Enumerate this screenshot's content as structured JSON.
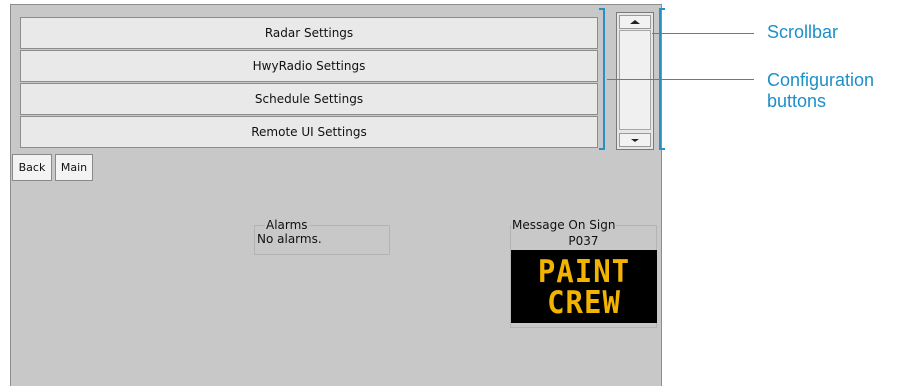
{
  "config_buttons": [
    "Radar Settings",
    "HwyRadio Settings",
    "Schedule Settings",
    "Remote UI Settings"
  ],
  "nav": {
    "back_label": "Back",
    "main_label": "Main"
  },
  "alarms": {
    "title": "Alarms",
    "status": "No alarms."
  },
  "sign": {
    "title": "Message On Sign",
    "code": "P037",
    "lines": [
      "PAINT",
      "CREW"
    ]
  },
  "callouts": {
    "scrollbar": "Scrollbar",
    "config_line1": "Configuration",
    "config_line2": "buttons"
  },
  "colors": {
    "callout": "#1d8fc8",
    "sign_text": "#f2b400",
    "sign_bg": "#000000",
    "screen_bg": "#c8c8c8"
  },
  "icons": {
    "scroll_up": "triangle-up-icon",
    "scroll_down": "triangle-down-icon"
  }
}
